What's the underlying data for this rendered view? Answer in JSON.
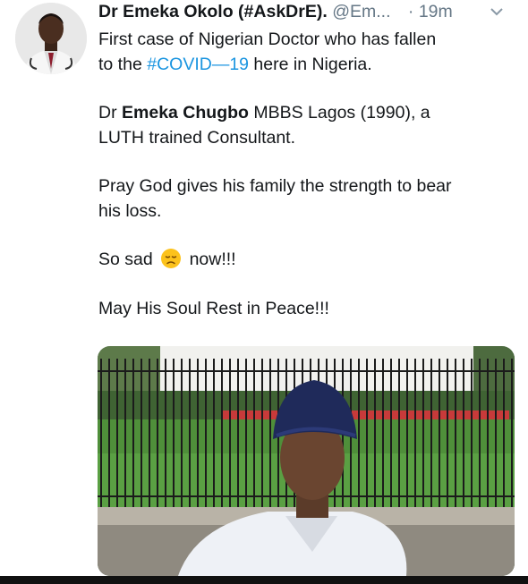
{
  "tweet": {
    "author_name": "Dr Emeka Okolo (#AskDrE).",
    "handle": "@Em...",
    "time": "· 19m",
    "line1_text": "First case of Nigerian Doctor who has fallen",
    "line2_prefix": "to the ",
    "hashtag": "#COVID—19",
    "line2_suffix": " here in Nigeria.",
    "p2_prefix": "Dr ",
    "p2_bold": "Emeka Chugbo",
    "p2_line1_rest": " MBBS Lagos (1990), a",
    "p2_line2": "LUTH trained Consultant.",
    "p3_line1": "Pray God gives his family the strength to bear",
    "p3_line2": "his loss.",
    "p4_before": "So sad",
    "p4_after": "now!!!",
    "p5": "May His Soul Rest in Peace!!!"
  },
  "icons": {
    "caret": "chevron-down-icon",
    "emoji": "disappointed-face-emoji"
  },
  "colors": {
    "hashtag": "#1b95e0",
    "secondary_text": "#657786"
  }
}
